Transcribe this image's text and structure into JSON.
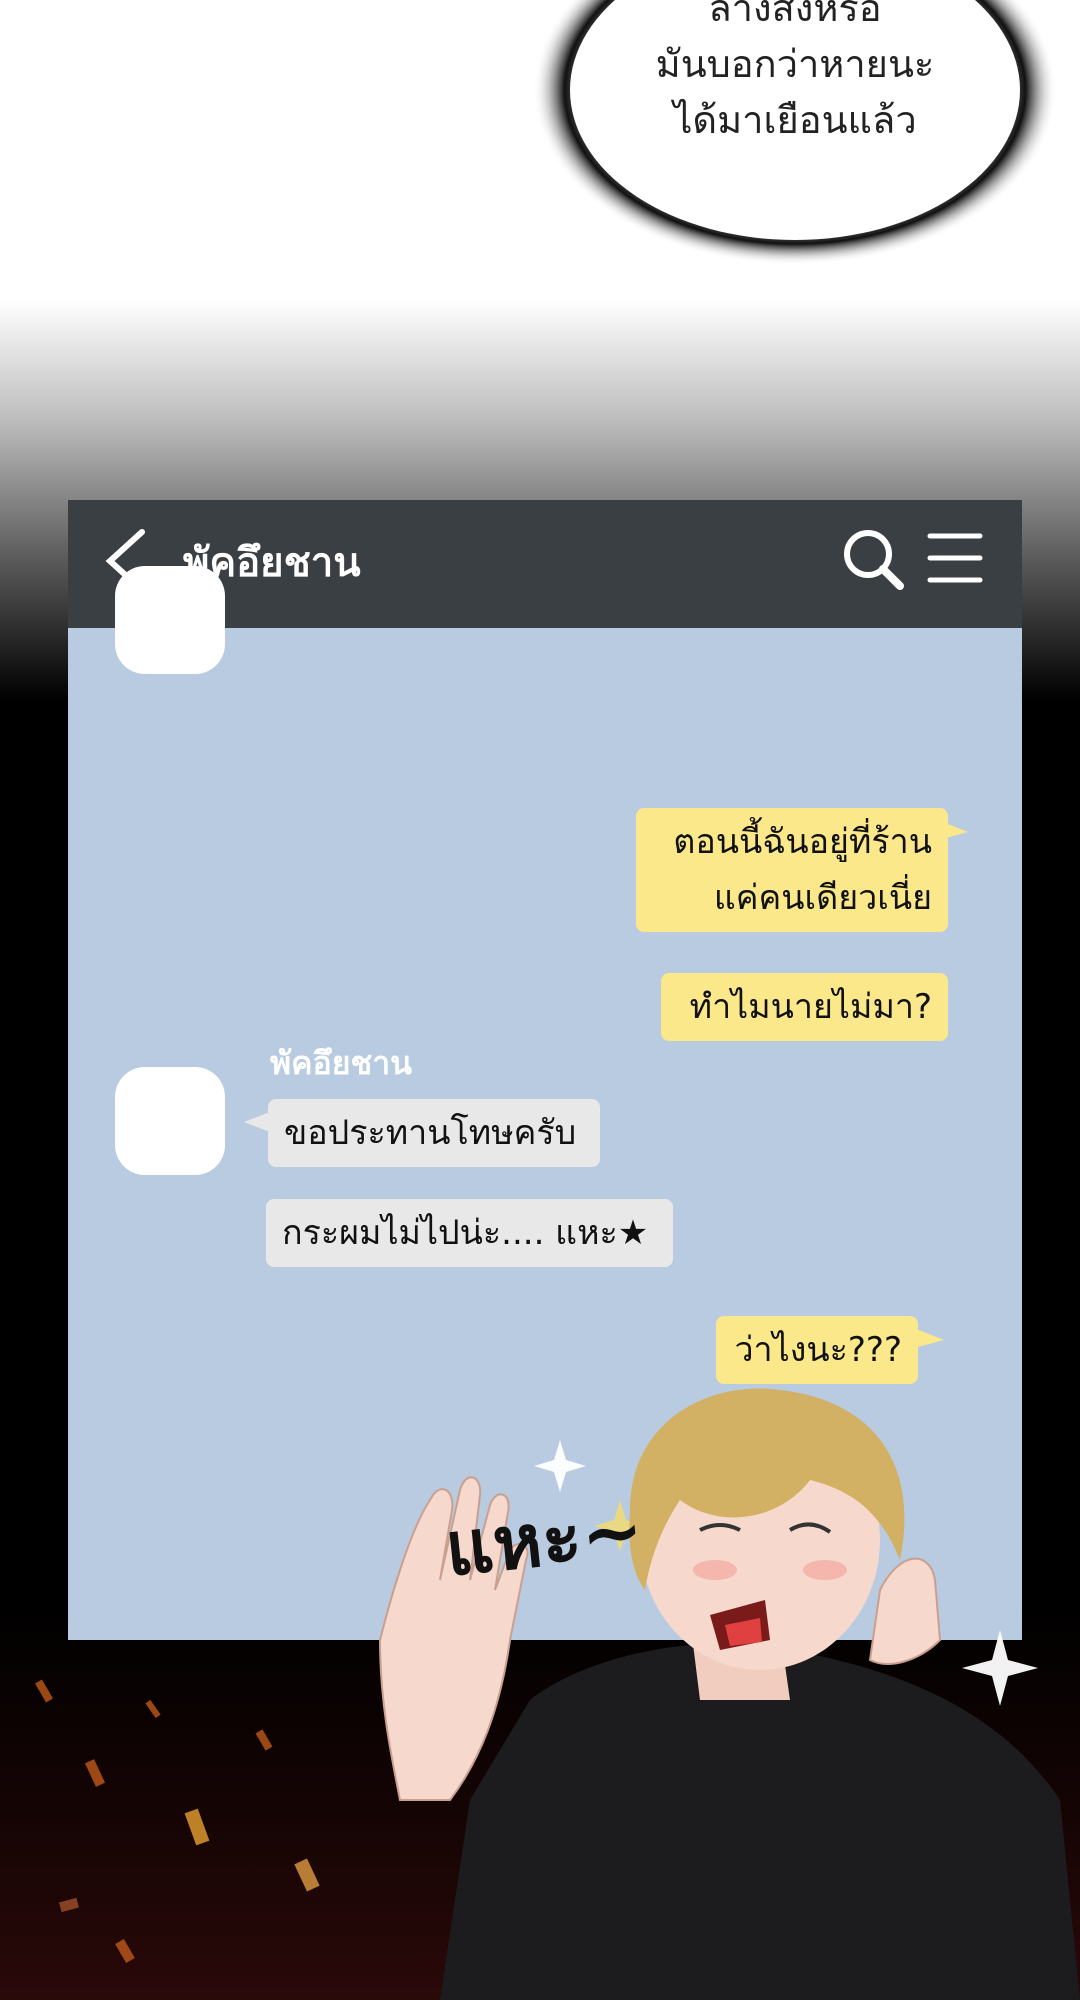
{
  "narration": {
    "lines": [
      "ล้างสิ่งหรือ",
      "มันบอกว่าหายนะ",
      "ได้มาเยือนแล้ว"
    ]
  },
  "chat_header": {
    "title": "พัคอึยชาน",
    "back_icon": "chevron-left-icon",
    "search_icon": "search-icon",
    "menu_icon": "hamburger-menu-icon"
  },
  "messages": [
    {
      "from": "me",
      "lines": [
        "ตอนนี้ฉันอยู่ที่ร้าน",
        "แค่คนเดียวเนี่ย"
      ]
    },
    {
      "from": "me",
      "lines": [
        "ทำไมนายไม่มา?"
      ]
    },
    {
      "from": "them",
      "sender": "พัคอึยชาน",
      "lines": [
        "ขอประทานโทษครับ"
      ]
    },
    {
      "from": "them",
      "lines": [
        "กระผมไม่ไปน่ะ.... แหะ★"
      ]
    },
    {
      "from": "me",
      "lines": [
        "ว่าไงนะ???"
      ]
    }
  ],
  "sfx": "แหะ~",
  "colors": {
    "header_bg": "#3a3f44",
    "chat_bg": "#b9cbe0",
    "my_bubble": "#fbe88a",
    "their_bubble": "#e8e8e8"
  }
}
